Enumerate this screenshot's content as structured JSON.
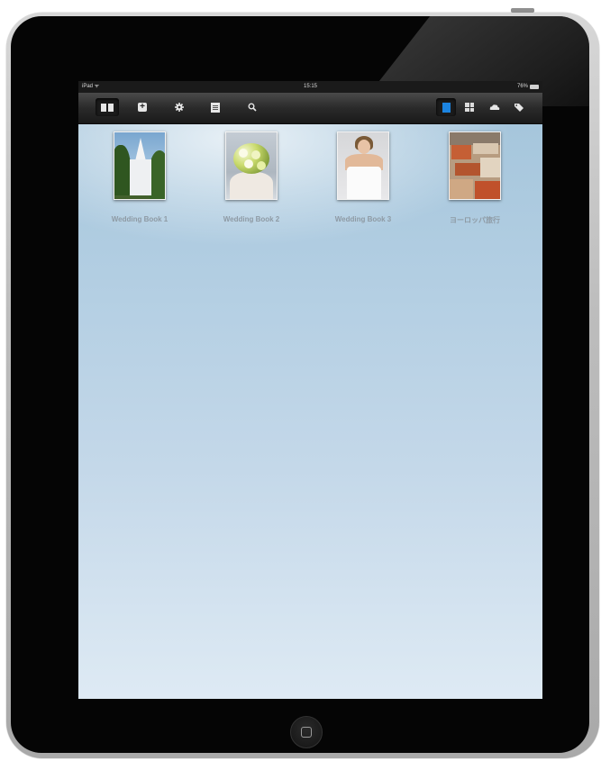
{
  "status_bar": {
    "carrier": "iPad ᯤ",
    "time": "15:15",
    "battery": "76%"
  },
  "toolbar": {
    "left": [
      {
        "name": "bookshelf",
        "icon": "book-icon"
      },
      {
        "name": "add",
        "icon": "plus-icon"
      },
      {
        "name": "settings",
        "icon": "gear-icon"
      },
      {
        "name": "notes",
        "icon": "note-icon"
      },
      {
        "name": "search",
        "icon": "search-icon"
      }
    ],
    "right": [
      {
        "name": "list-view",
        "icon": "list-view-icon"
      },
      {
        "name": "grid-view",
        "icon": "grid-icon"
      },
      {
        "name": "cloud",
        "icon": "cloud-icon"
      },
      {
        "name": "tags",
        "icon": "tag-icon"
      }
    ],
    "accent": "#1c84e0"
  },
  "books": [
    {
      "title": "Wedding Book 1",
      "cover": "church"
    },
    {
      "title": "Wedding Book 2",
      "cover": "bouquet"
    },
    {
      "title": "Wedding Book 3",
      "cover": "bride"
    },
    {
      "title": "ヨーロッパ旅行",
      "cover": "rooftops"
    }
  ]
}
